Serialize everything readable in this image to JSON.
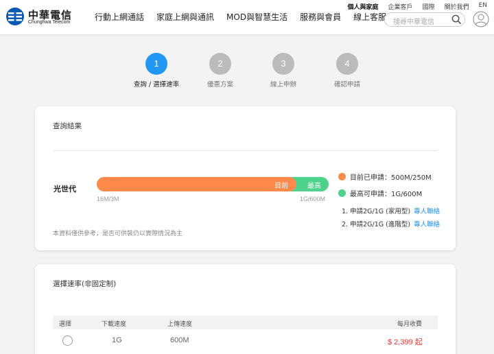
{
  "brand": {
    "name_cn": "中華電信",
    "name_en": "Chunghwa Telecom",
    "color": "#0a5bb0"
  },
  "top_links": [
    {
      "label": "個人與家庭",
      "current": true
    },
    {
      "label": "企業客戶"
    },
    {
      "label": "國際"
    },
    {
      "label": "關於我們"
    },
    {
      "label": "EN"
    }
  ],
  "main_nav": [
    "行動上網通話",
    "家庭上網與通訊",
    "MOD與智慧生活",
    "服務與會員",
    "線上客服"
  ],
  "search": {
    "placeholder": "搜尋中華電信"
  },
  "steps": [
    {
      "number": "1",
      "label": "查詢 / 選擇速率",
      "active": true
    },
    {
      "number": "2",
      "label": "優惠方案"
    },
    {
      "number": "3",
      "label": "線上申辦"
    },
    {
      "number": "4",
      "label": "確認申請"
    }
  ],
  "result": {
    "title": "查詢結果",
    "product": "光世代",
    "bar": {
      "current_label": "目前",
      "max_label": "最高",
      "min_tick": "16M/3M",
      "max_tick": "1G/600M",
      "current_fraction": 0.86
    },
    "legend": [
      {
        "label": "目前已申請：500M/250M",
        "color": "#ff8a4c"
      },
      {
        "label": "最高可申請：1G/600M",
        "color": "#4cd28a"
      }
    ],
    "plans": [
      {
        "text": "1. 申請2G/1G (家用型)",
        "link": "專人聯絡"
      },
      {
        "text": "2. 申請2G/1G (進階型)",
        "link": "專人聯絡"
      }
    ],
    "note": "本資料僅供參考，是否可供裝仍以實際情況為主"
  },
  "speed": {
    "title": "選擇速率(非固定制)",
    "columns": [
      "選擇",
      "下載速度",
      "上傳速度",
      "每月收費"
    ],
    "rows": [
      {
        "download": "1G",
        "upload": "600M",
        "price": "$ 2,399 起"
      }
    ]
  }
}
